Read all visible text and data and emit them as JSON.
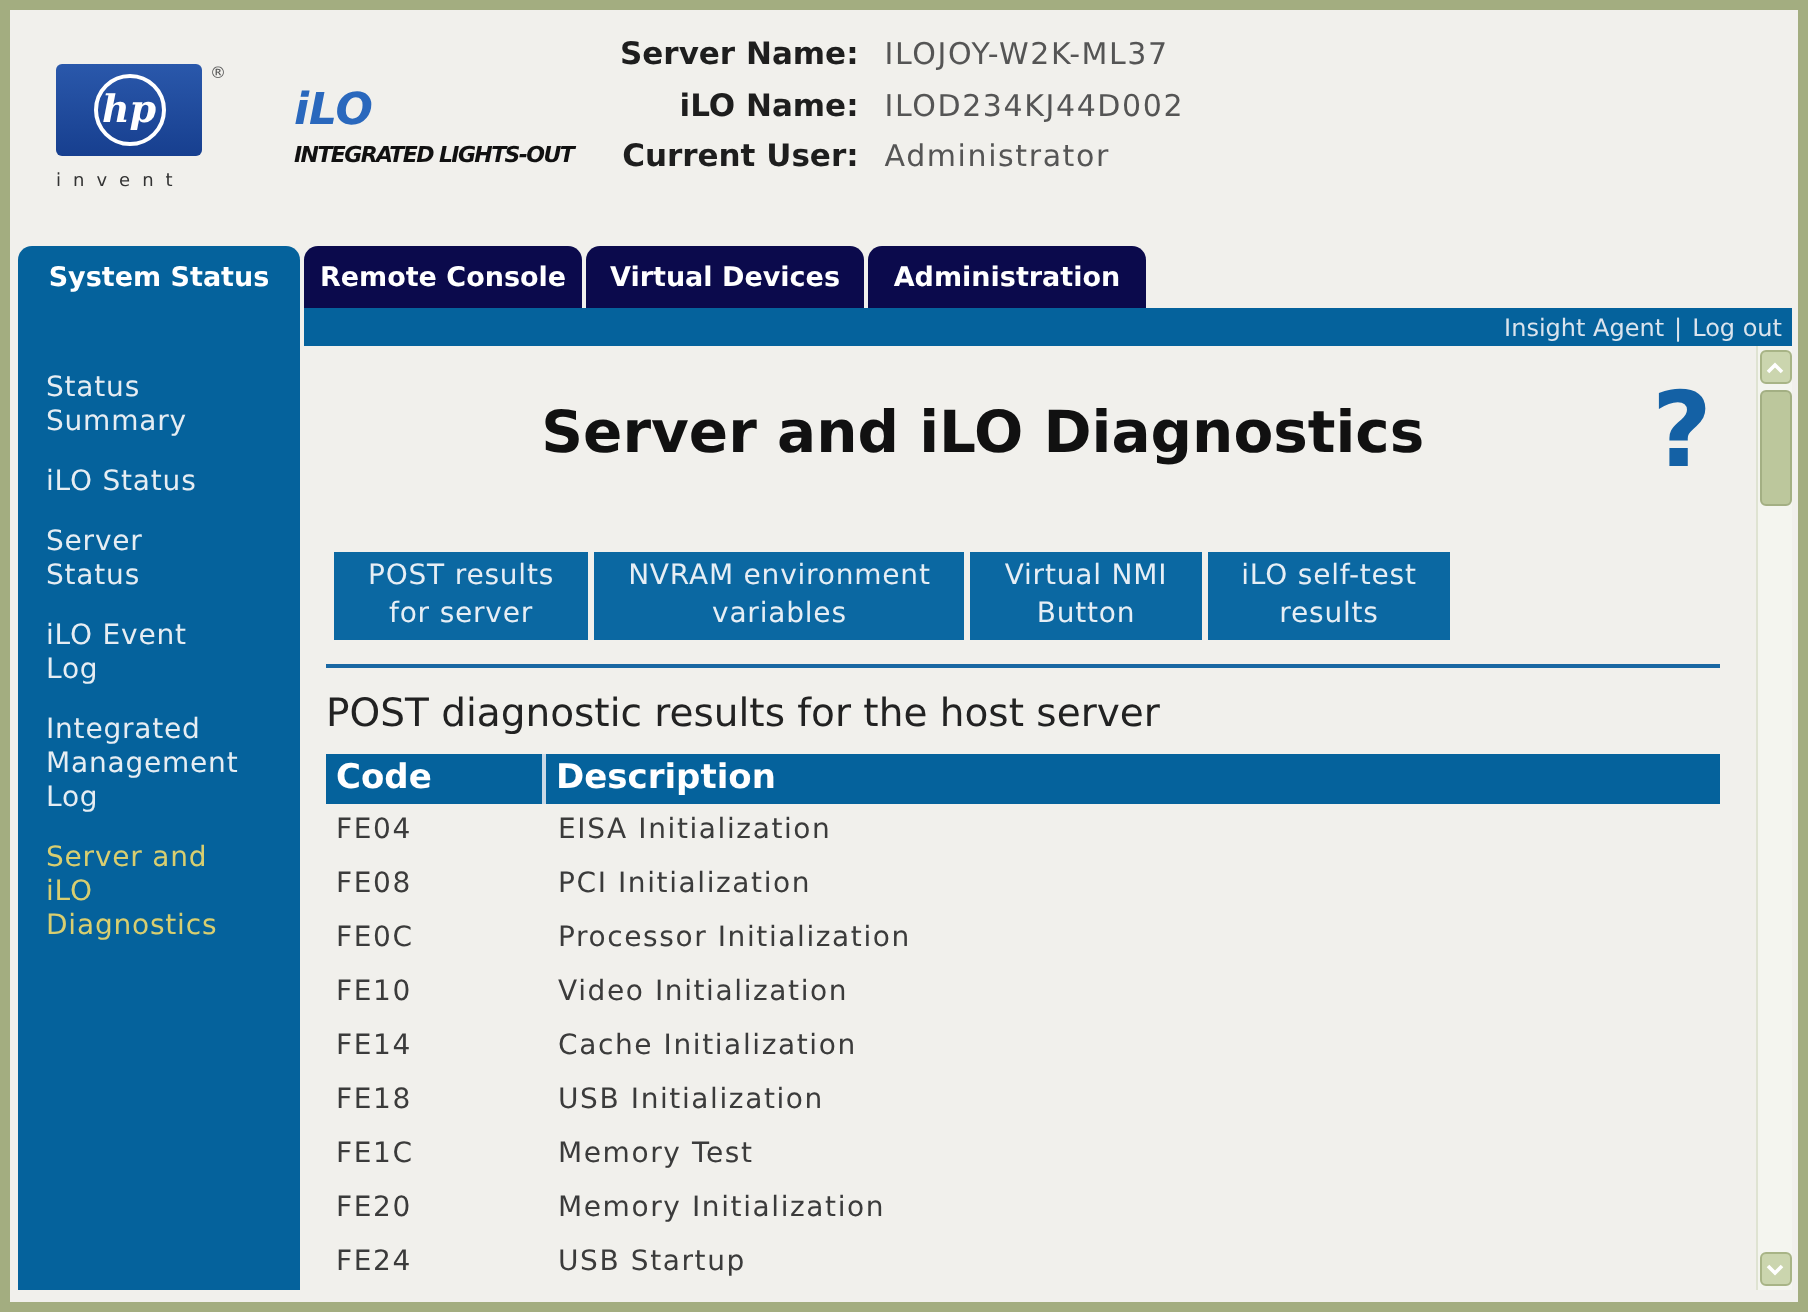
{
  "header": {
    "logo": {
      "mark": "hp",
      "registered": "®",
      "tagline": "invent"
    },
    "product": {
      "name": "iLO",
      "subtitle": "INTEGRATED LIGHTS-OUT"
    },
    "info": [
      {
        "label": "Server Name:",
        "value": "ILOJOY-W2K-ML37"
      },
      {
        "label": "iLO Name:",
        "value": "ILOD234KJ44D002"
      },
      {
        "label": "Current User:",
        "value": "Administrator"
      }
    ]
  },
  "tabs": [
    {
      "label": "System Status",
      "selected": true
    },
    {
      "label": "Remote Console",
      "selected": false
    },
    {
      "label": "Virtual Devices",
      "selected": false
    },
    {
      "label": "Administration",
      "selected": false
    }
  ],
  "top_links": {
    "items": [
      {
        "label": "Insight Agent"
      },
      {
        "label": "Log out"
      }
    ],
    "separator": "|"
  },
  "sidebar": {
    "items": [
      {
        "label": "Status\nSummary",
        "selected": false
      },
      {
        "label": "iLO Status",
        "selected": false
      },
      {
        "label": "Server\nStatus",
        "selected": false
      },
      {
        "label": "iLO Event\nLog",
        "selected": false
      },
      {
        "label": "Integrated\nManagement\nLog",
        "selected": false
      },
      {
        "label": "Server and\niLO\nDiagnostics",
        "selected": true
      }
    ]
  },
  "content": {
    "title": "Server and iLO Diagnostics",
    "help": "?",
    "section_buttons": [
      {
        "label": "POST results\nfor server"
      },
      {
        "label": "NVRAM environment\nvariables"
      },
      {
        "label": "Virtual NMI\nButton"
      },
      {
        "label": "iLO self-test\nresults"
      }
    ],
    "section_title": "POST diagnostic results for the host server",
    "table": {
      "columns": [
        "Code",
        "Description"
      ],
      "rows": [
        {
          "code": "FE04",
          "description": "EISA Initialization"
        },
        {
          "code": "FE08",
          "description": "PCI Initialization"
        },
        {
          "code": "FE0C",
          "description": "Processor Initialization"
        },
        {
          "code": "FE10",
          "description": "Video Initialization"
        },
        {
          "code": "FE14",
          "description": "Cache Initialization"
        },
        {
          "code": "FE18",
          "description": "USB Initialization"
        },
        {
          "code": "FE1C",
          "description": "Memory Test"
        },
        {
          "code": "FE20",
          "description": "Memory Initialization"
        },
        {
          "code": "FE24",
          "description": "USB Startup"
        }
      ]
    }
  }
}
